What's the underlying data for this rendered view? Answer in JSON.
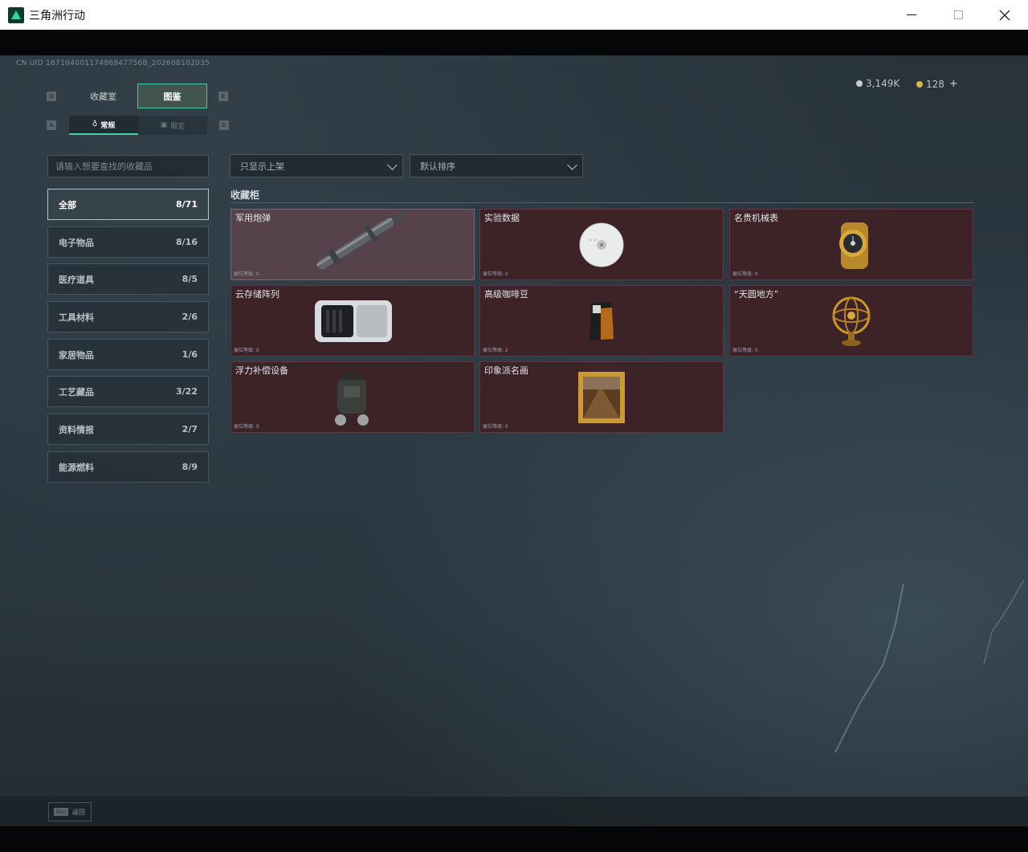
{
  "window": {
    "title": "三角洲行动"
  },
  "uid": "CN UID 18710400117486947756B_202608102035",
  "currency": {
    "silver": "3,149K",
    "gold": "128",
    "plus": "+"
  },
  "tabs": {
    "left_key": "Q",
    "right_key": "E",
    "items": [
      {
        "label": "收藏室"
      },
      {
        "label": "图鉴"
      }
    ]
  },
  "subtabs": {
    "left_key": "A",
    "right_key": "D",
    "items": [
      {
        "label": "常规"
      },
      {
        "label": "限定"
      }
    ]
  },
  "search": {
    "placeholder": "请输入想要查找的收藏品"
  },
  "filters": [
    {
      "value": "只显示上架"
    },
    {
      "value": "默认排序"
    }
  ],
  "categories": [
    {
      "label": "全部",
      "count": "8/71"
    },
    {
      "label": "电子物品",
      "count": "8/16"
    },
    {
      "label": "医疗道具",
      "count": "8/5"
    },
    {
      "label": "工具材料",
      "count": "2/6"
    },
    {
      "label": "家居物品",
      "count": "1/6"
    },
    {
      "label": "工艺藏品",
      "count": "3/22"
    },
    {
      "label": "资料情报",
      "count": "2/7"
    },
    {
      "label": "能源燃料",
      "count": "8/9"
    }
  ],
  "section": {
    "title": "收藏柜"
  },
  "cards": [
    {
      "name": "军用炮弹",
      "level": "展位等级: 0",
      "icon": "missile-icon"
    },
    {
      "name": "实验数据",
      "level": "展位等级: 0",
      "icon": "disc-icon"
    },
    {
      "name": "名贵机械表",
      "level": "展位等级: 0",
      "icon": "watch-icon"
    },
    {
      "name": "云存储阵列",
      "level": "展位等级: 0",
      "icon": "server-icon"
    },
    {
      "name": "高级咖啡豆",
      "level": "展位等级: 2",
      "icon": "coffee-bag-icon"
    },
    {
      "name": "“天圆地方”",
      "level": "展位等级: 0",
      "icon": "armillary-icon"
    },
    {
      "name": "浮力补偿设备",
      "level": "展位等级: 0",
      "icon": "dive-gear-icon"
    },
    {
      "name": "印象派名画",
      "level": "展位等级: 0",
      "icon": "painting-icon"
    }
  ],
  "footer": {
    "esc_key": "Esc",
    "back_label": "返回"
  },
  "colors": {
    "accent": "#3cd49a",
    "card_bg": "#3d2227",
    "card_highlight": "#55424a"
  }
}
